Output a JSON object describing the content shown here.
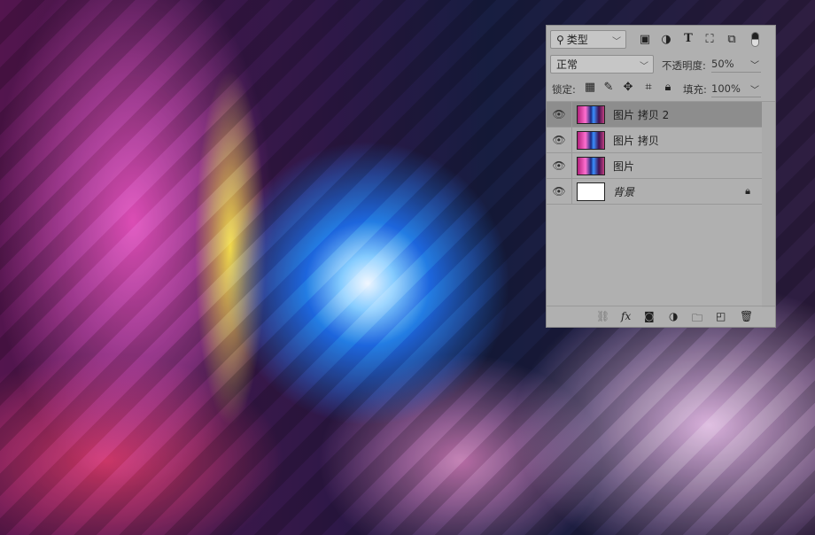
{
  "panel": {
    "filter": {
      "icon": "search-icon",
      "label": "类型"
    },
    "filter_icons": [
      "image-filter-icon",
      "adjustment-filter-icon",
      "text-filter-icon",
      "shape-filter-icon",
      "smart-object-filter-icon",
      "filter-toggle-icon"
    ],
    "blend_mode": "正常",
    "opacity_label": "不透明度:",
    "opacity_value": "50%",
    "lock_label": "锁定:",
    "lock_icons": [
      "lock-transparent-icon",
      "lock-paint-icon",
      "lock-position-icon",
      "lock-artboard-icon",
      "lock-all-icon"
    ],
    "fill_label": "填充:",
    "fill_value": "100%",
    "layers": [
      {
        "name": "图片 拷贝 2",
        "active": true
      },
      {
        "name": "图片 拷贝",
        "active": false
      },
      {
        "name": "图片",
        "active": false
      },
      {
        "name": "背景",
        "active": false,
        "locked": true
      }
    ],
    "footer_icons": [
      "link-icon",
      "fx-icon",
      "mask-icon",
      "adjustment-layer-icon",
      "folder-icon",
      "new-layer-icon",
      "trash-icon"
    ],
    "fx_label": "fx"
  }
}
